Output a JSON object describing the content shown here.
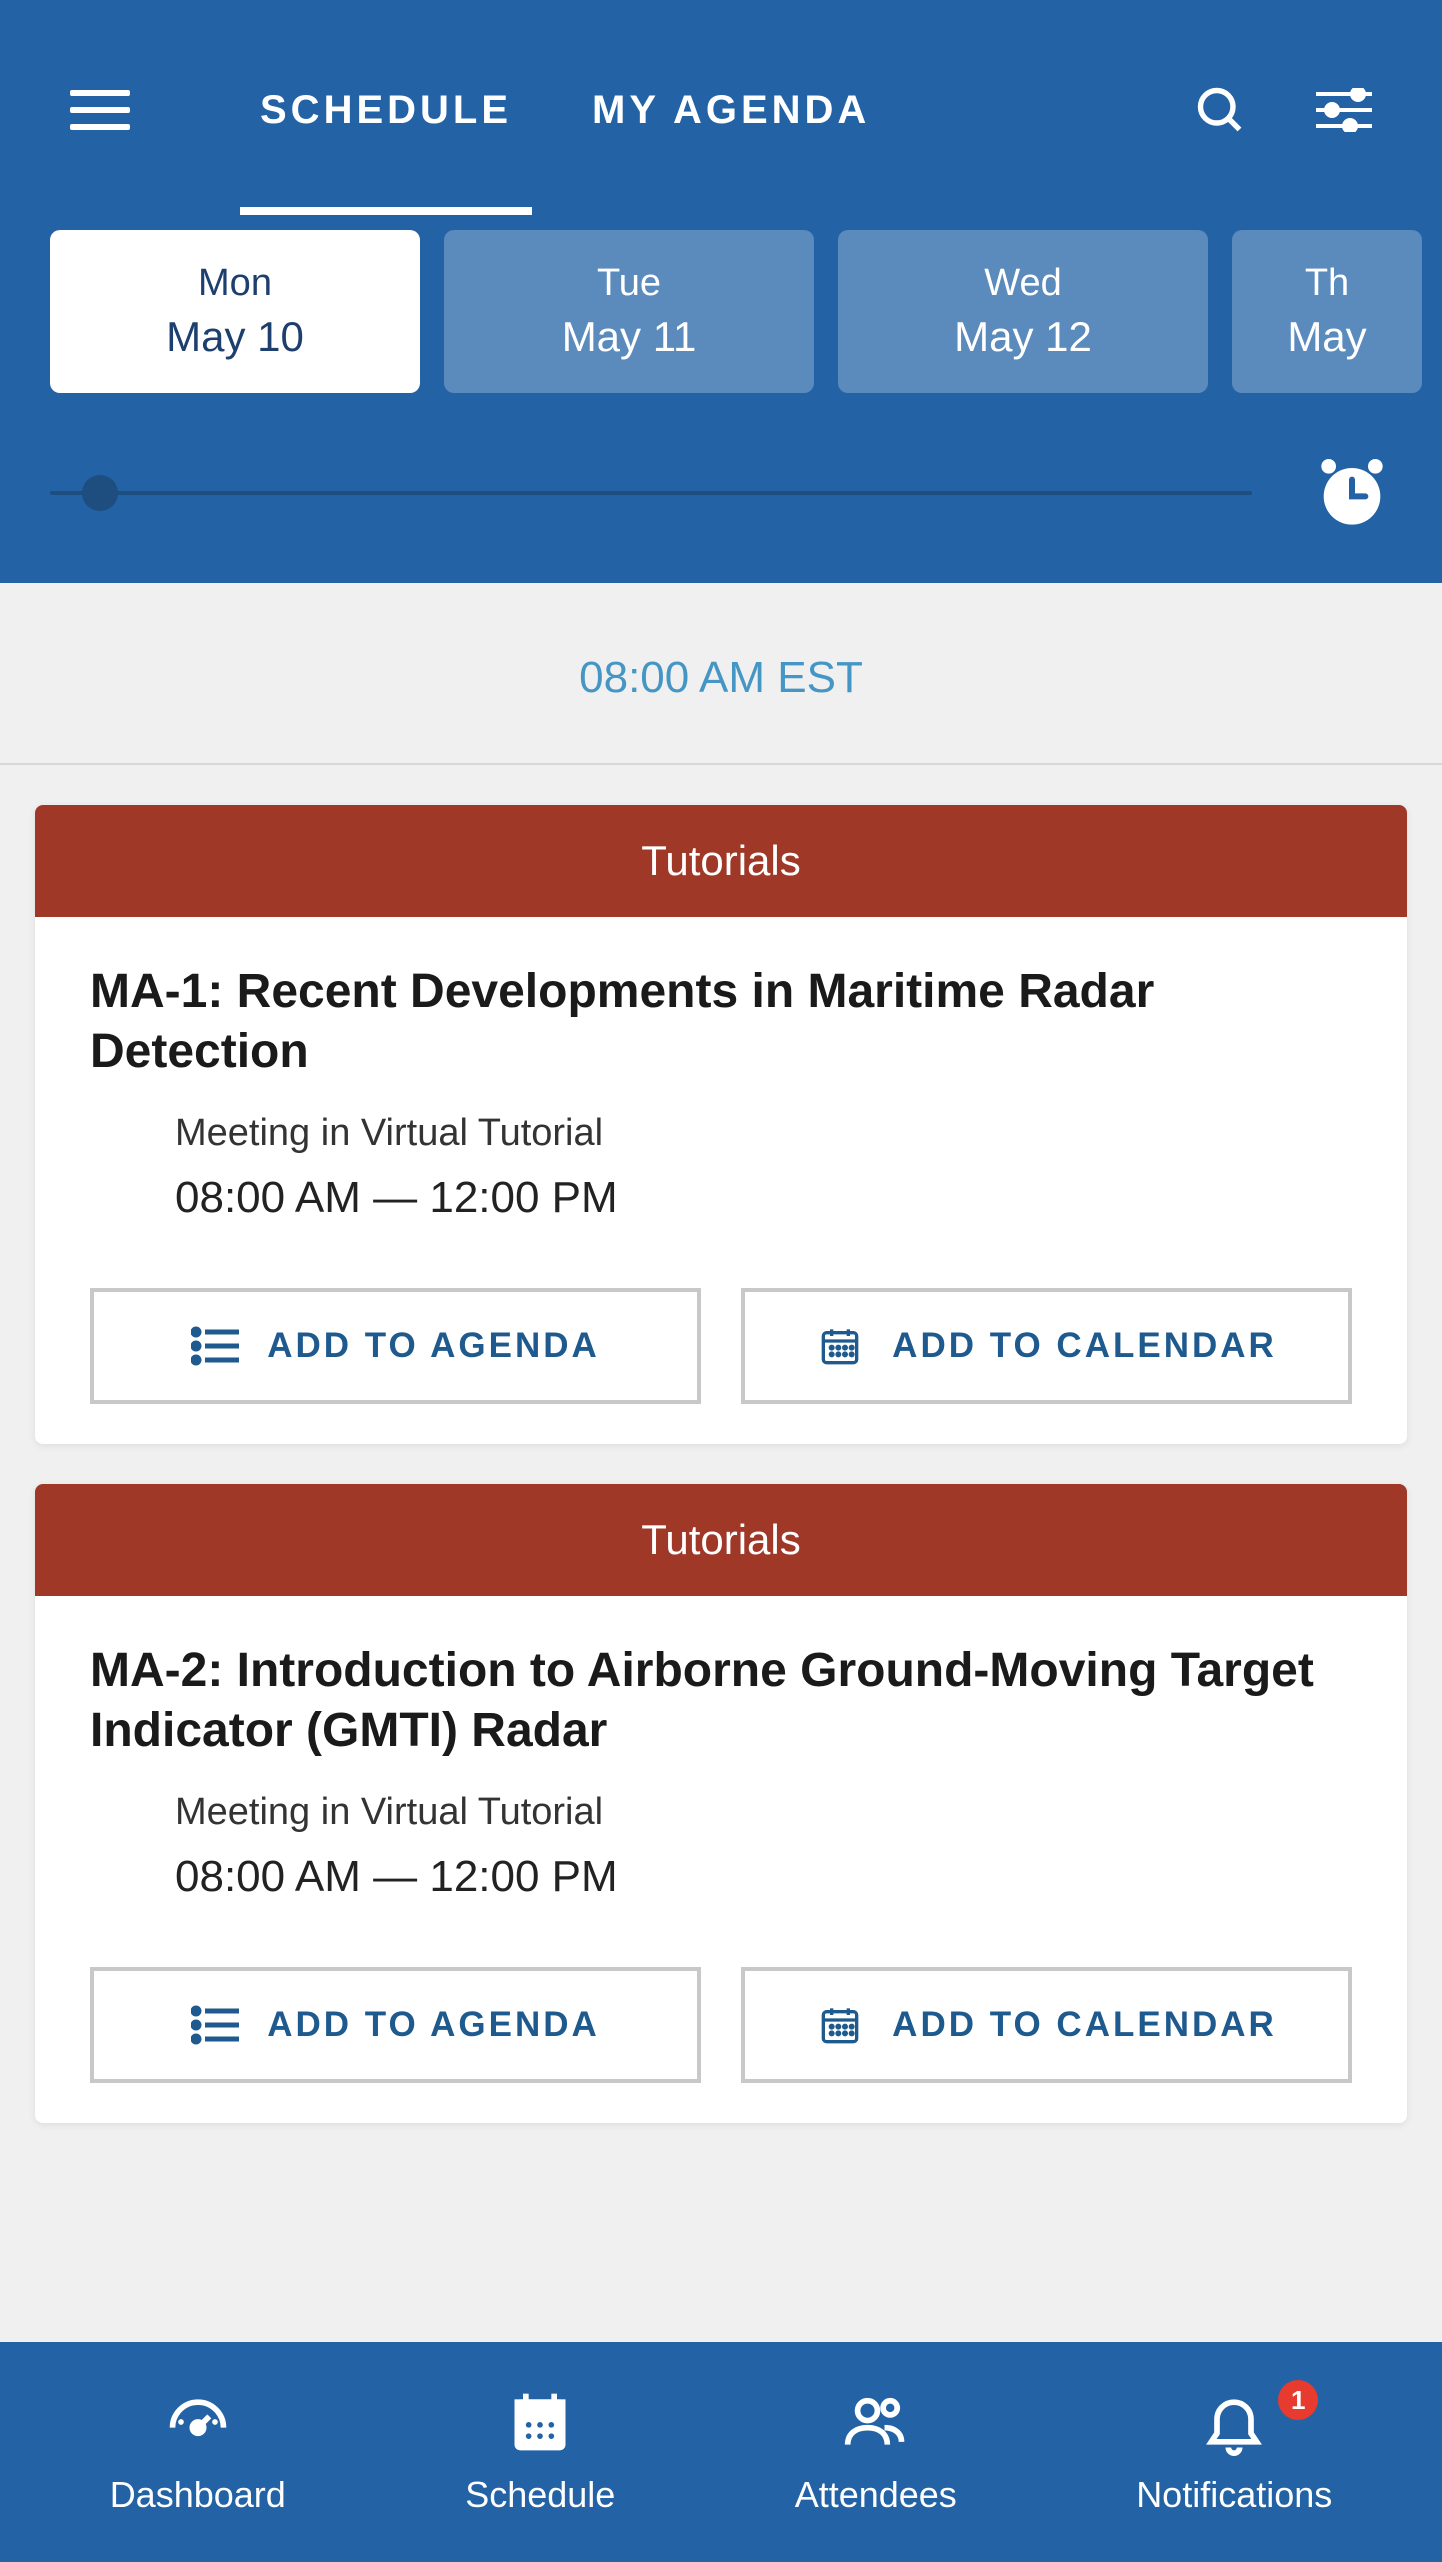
{
  "header": {
    "tabs": [
      {
        "label": "SCHEDULE",
        "active": true
      },
      {
        "label": "MY AGENDA",
        "active": false
      }
    ]
  },
  "dayTabs": [
    {
      "day": "Mon",
      "date": "May 10",
      "active": true
    },
    {
      "day": "Tue",
      "date": "May 11",
      "active": false
    },
    {
      "day": "Wed",
      "date": "May 12",
      "active": false
    },
    {
      "day": "Th",
      "date": "May",
      "active": false
    }
  ],
  "timeHeader": "08:00 AM EST",
  "actions": {
    "addAgenda": "ADD TO AGENDA",
    "addCalendar": "ADD TO CALENDAR"
  },
  "events": [
    {
      "category": "Tutorials",
      "title": "MA-1: Recent Developments in Maritime Radar Detection",
      "location": "Meeting in Virtual Tutorial",
      "time": "08:00 AM  —  12:00 PM"
    },
    {
      "category": "Tutorials",
      "title": "MA-2: Introduction to Airborne Ground-Moving Target Indicator (GMTI) Radar",
      "location": "Meeting in Virtual Tutorial",
      "time": "08:00 AM  —  12:00 PM"
    }
  ],
  "bottomNav": {
    "dashboard": "Dashboard",
    "schedule": "Schedule",
    "attendees": "Attendees",
    "notifications": "Notifications",
    "notificationBadge": "1"
  }
}
